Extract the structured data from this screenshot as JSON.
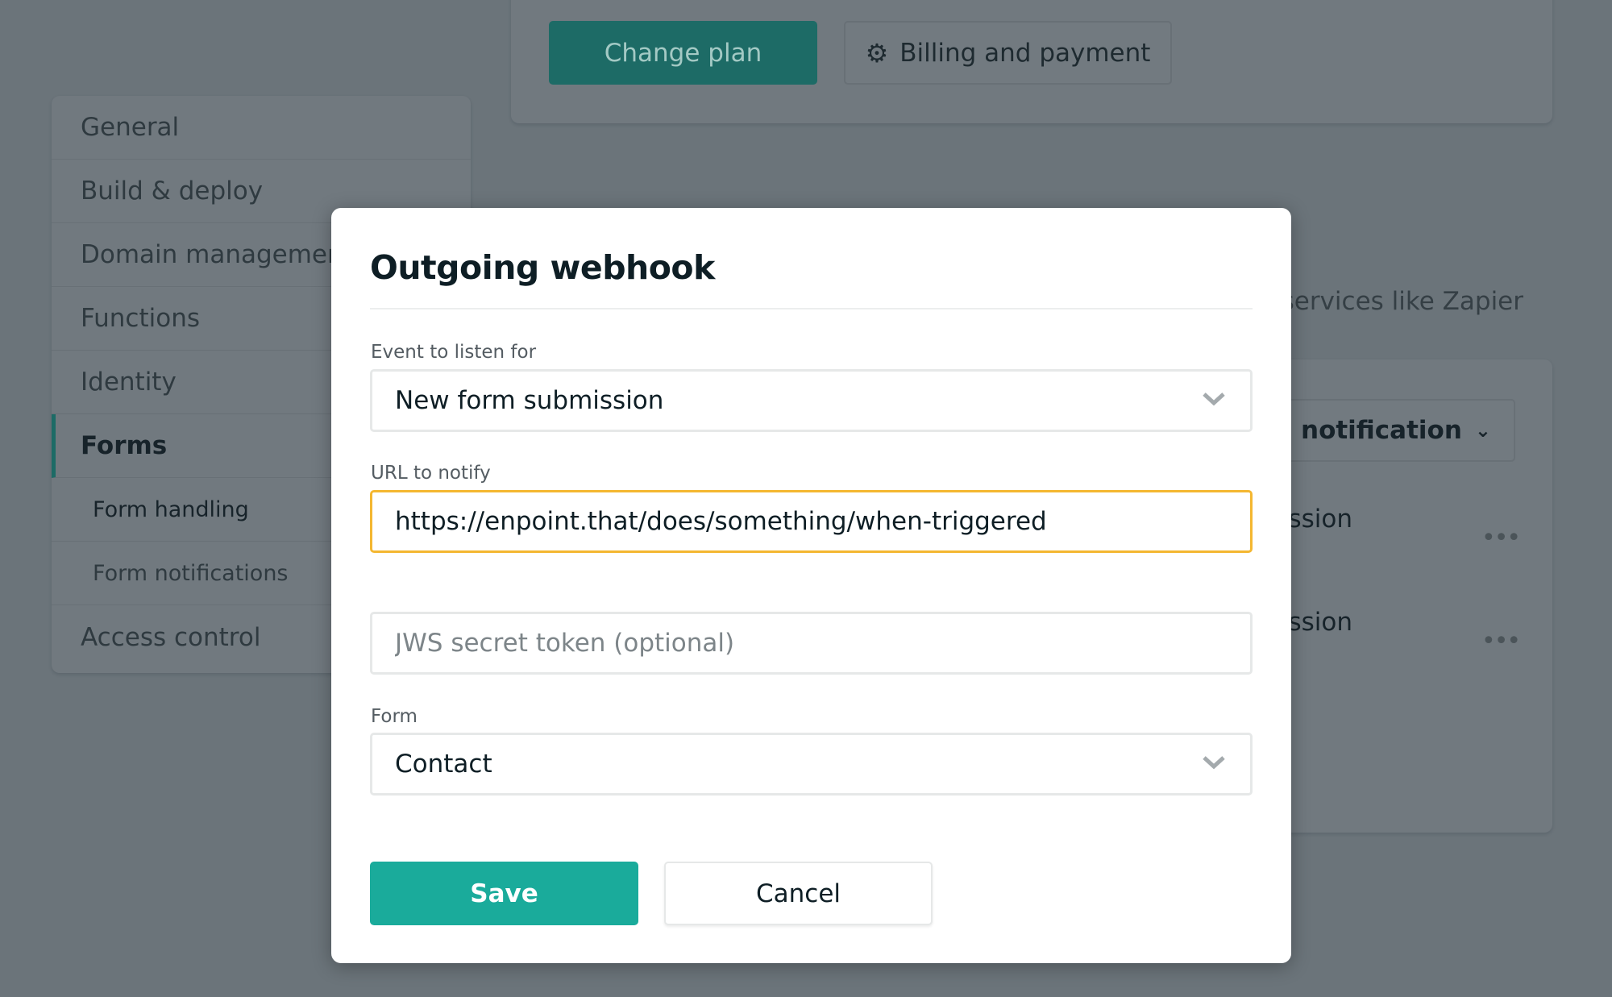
{
  "header": {
    "change_plan": "Change plan",
    "billing": "Billing and payment"
  },
  "sidebar": {
    "items": [
      {
        "label": "General"
      },
      {
        "label": "Build & deploy"
      },
      {
        "label": "Domain management"
      },
      {
        "label": "Functions"
      },
      {
        "label": "Identity"
      },
      {
        "label": "Forms",
        "active": true
      },
      {
        "label": "Form handling",
        "sub": true
      },
      {
        "label": "Form notifications",
        "sub": true
      },
      {
        "label": "Access control"
      }
    ]
  },
  "background": {
    "description_fragment": "services like Zapier",
    "add_notification": "Add notification",
    "rows": [
      "New form submission",
      "New form submission"
    ]
  },
  "modal": {
    "title": "Outgoing webhook",
    "event_label": "Event to listen for",
    "event_value": "New form submission",
    "url_label": "URL to notify",
    "url_value": "https://enpoint.that/does/something/when-triggered",
    "token_placeholder": "JWS secret token (optional)",
    "form_label": "Form",
    "form_value": "Contact",
    "save": "Save",
    "cancel": "Cancel"
  },
  "colors": {
    "primary": "#1aab9b",
    "focus_border": "#f4b731",
    "change_plan": "#15847b"
  }
}
